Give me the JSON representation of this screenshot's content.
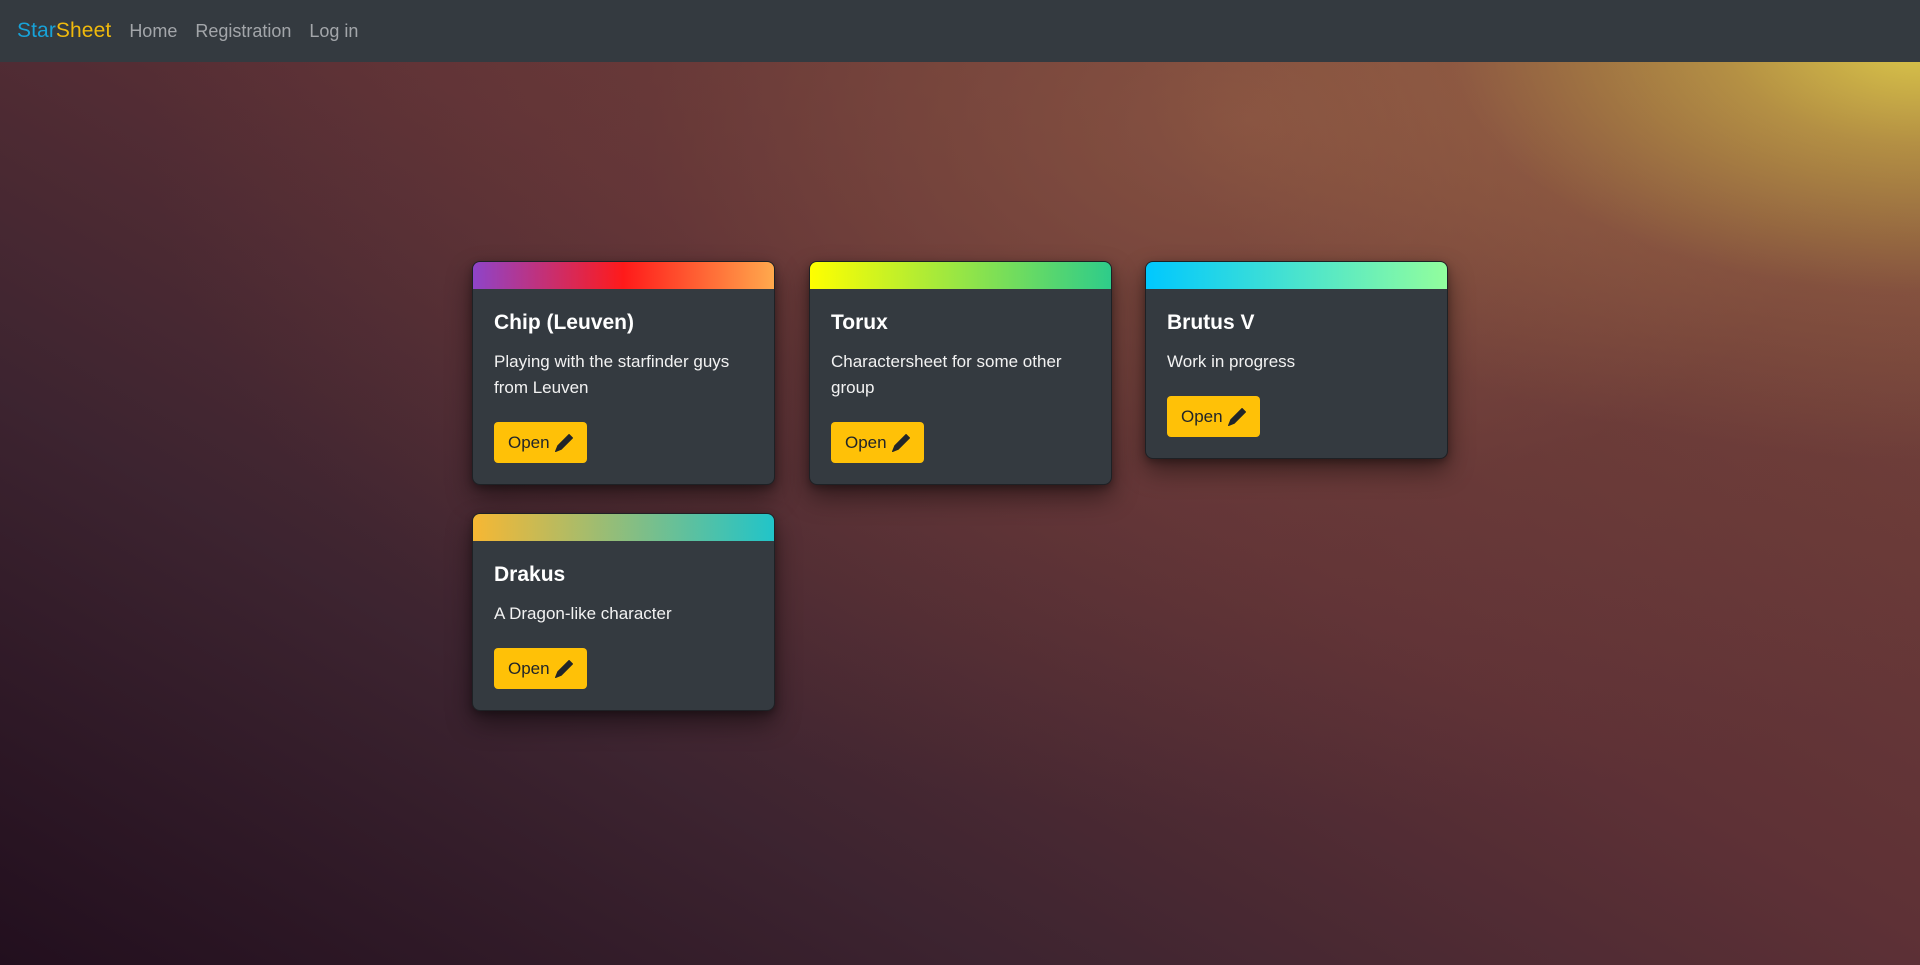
{
  "navbar": {
    "brand_star": "Star",
    "brand_sheet": "Sheet",
    "links": [
      "Home",
      "Registration",
      "Log in"
    ]
  },
  "colors": {
    "brand_blue": "#17a2d8",
    "brand_yellow": "#f0b90c",
    "button_yellow": "#ffc107",
    "card_bg": "#343a40"
  },
  "cards": [
    {
      "title": "Chip (Leuven)",
      "description": "Playing with the starfinder guys from Leuven",
      "button_label": "Open",
      "button_icon": "pencil-icon",
      "strip_colors": [
        "#8e44c9",
        "#ff1a1a",
        "#ffa94d"
      ]
    },
    {
      "title": "Torux",
      "description": "Charactersheet for some other group",
      "button_label": "Open",
      "button_icon": "pencil-icon",
      "strip_colors": [
        "#ffff00",
        "#2ecc8a"
      ]
    },
    {
      "title": "Brutus V",
      "description": "Work in progress",
      "button_label": "Open",
      "button_icon": "pencil-icon",
      "strip_colors": [
        "#00c8ff",
        "#92fe9d"
      ]
    },
    {
      "title": "Drakus",
      "description": "A Dragon-like character",
      "button_label": "Open",
      "button_icon": "pencil-icon",
      "strip_colors": [
        "#f7b733",
        "#21c4c9"
      ]
    }
  ]
}
